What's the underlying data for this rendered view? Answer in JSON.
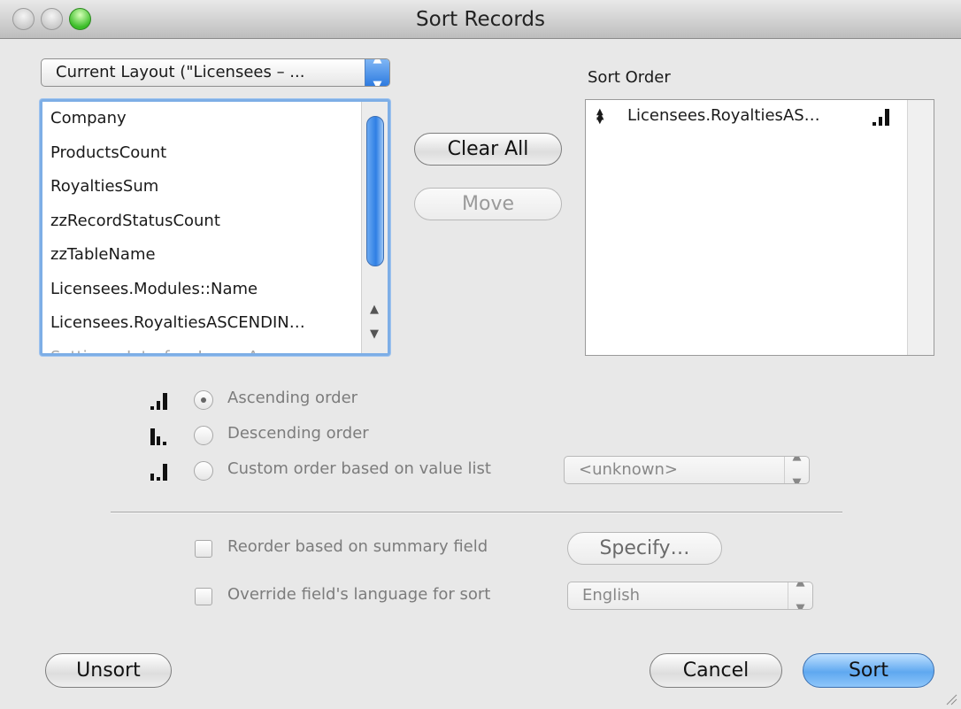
{
  "window": {
    "title": "Sort Records"
  },
  "layout_popup": {
    "value": "Current Layout (\"Licensees – ..."
  },
  "fields": [
    "Company",
    "ProductsCount",
    "RoyaltiesSum",
    "zzRecordStatusCount",
    "zzTableName",
    "Licensees.Modules::Name",
    "Licensees.RoyaltiesASCENDIN…",
    "Settings::InterfaceImageArrow…"
  ],
  "buttons": {
    "clear_all": "Clear All",
    "move": "Move",
    "specify": "Specify…",
    "unsort": "Unsort",
    "cancel": "Cancel",
    "sort": "Sort"
  },
  "sort_order": {
    "label": "Sort Order",
    "items": [
      {
        "field": "Licensees.RoyaltiesAS…",
        "direction": "ascending"
      }
    ]
  },
  "order_options": {
    "ascending": "Ascending order",
    "descending": "Descending order",
    "custom": "Custom order based on value list",
    "selected": "ascending"
  },
  "value_list_popup": {
    "value": "<unknown>"
  },
  "summary": {
    "label": "Reorder based on summary field",
    "checked": false
  },
  "language": {
    "label": "Override field's language for sort",
    "checked": false,
    "value": "English"
  },
  "colors": {
    "accent": "#5fa8f0",
    "focus_ring": "#7daee6",
    "disabled_text": "#7c7c7c"
  }
}
